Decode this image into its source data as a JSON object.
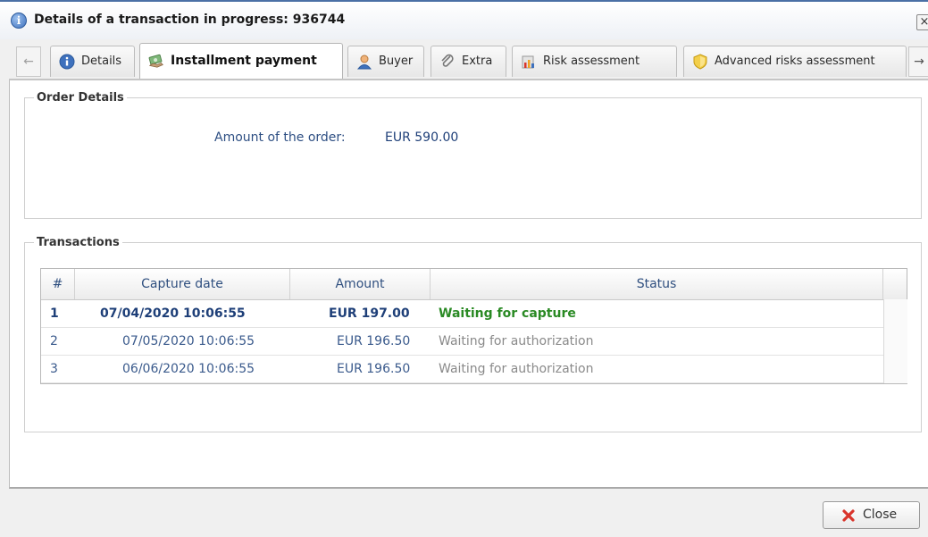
{
  "window": {
    "title": "Details of a transaction in progress: 936744",
    "close_glyph": "×"
  },
  "tabs": [
    {
      "label": "Details",
      "icon": "info-icon",
      "active": false
    },
    {
      "label": "Installment payment",
      "icon": "installment-icon",
      "active": true
    },
    {
      "label": "Buyer",
      "icon": "buyer-icon",
      "active": false
    },
    {
      "label": "Extra",
      "icon": "paperclip-icon",
      "active": false
    },
    {
      "label": "Risk assessment",
      "icon": "risk-chart-icon",
      "active": false
    },
    {
      "label": "Advanced risks assessment",
      "icon": "shield-icon",
      "active": false
    }
  ],
  "tab_scroll": {
    "left_glyph": "←",
    "right_glyph": "→"
  },
  "order_details": {
    "legend": "Order Details",
    "amount_label": "Amount of the order:",
    "amount_value": "EUR 590.00"
  },
  "transactions": {
    "legend": "Transactions",
    "columns": [
      "#",
      "Capture date",
      "Amount",
      "Status"
    ],
    "rows": [
      {
        "num": "1",
        "date": "07/04/2020 10:06:55",
        "amount": "EUR 197.00",
        "status": "Waiting for capture",
        "state": "current"
      },
      {
        "num": "2",
        "date": "07/05/2020 10:06:55",
        "amount": "EUR 196.50",
        "status": "Waiting for authorization",
        "state": "pending"
      },
      {
        "num": "3",
        "date": "06/06/2020 10:06:55",
        "amount": "EUR 196.50",
        "status": "Waiting for authorization",
        "state": "pending"
      }
    ]
  },
  "footer": {
    "close_label": "Close"
  },
  "colors": {
    "accent": "#4a6fa5",
    "label_blue": "#2e4f83",
    "status_success": "#2a8a24",
    "status_pending": "#8a8a8a",
    "close_red": "#d9342b"
  }
}
